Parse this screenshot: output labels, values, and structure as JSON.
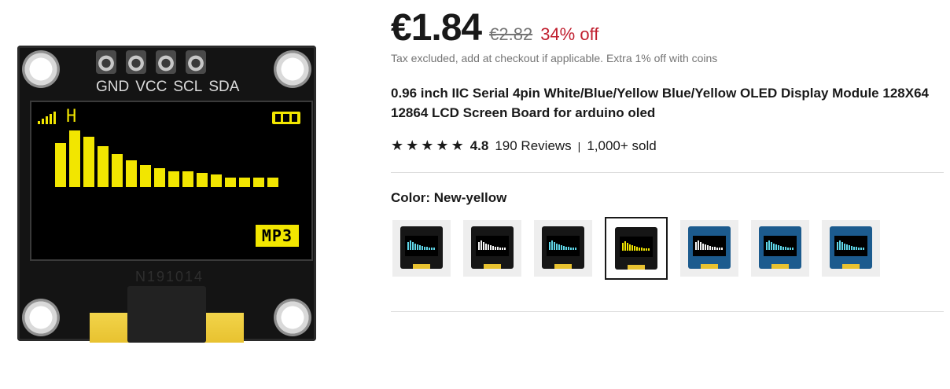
{
  "product_image": {
    "pin_labels": [
      "GND",
      "VCC",
      "SCL",
      "SDA"
    ],
    "screen_letter": "H",
    "screen_badge": "MP3",
    "chip_label": "N191014",
    "display_color": "#f2e600"
  },
  "price": {
    "current": "€1.84",
    "original": "€2.82",
    "discount": "34% off",
    "note": "Tax excluded, add at checkout if applicable. Extra 1% off with coins"
  },
  "title": "0.96 inch IIC Serial 4pin White/Blue/Yellow Blue/Yellow OLED Display Module 128X64 12864 LCD Screen Board for arduino oled",
  "rating": {
    "stars": 5,
    "value": "4.8",
    "reviews": "190 Reviews",
    "sold": "1,000+ sold"
  },
  "color": {
    "label": "Color: New-yellow",
    "options": [
      {
        "variant": "cyan",
        "board": "black",
        "selected": false
      },
      {
        "variant": "white",
        "board": "black",
        "selected": false
      },
      {
        "variant": "cyan",
        "board": "black",
        "selected": false
      },
      {
        "variant": "yellow",
        "board": "black",
        "selected": true
      },
      {
        "variant": "white",
        "board": "blue",
        "selected": false
      },
      {
        "variant": "cyan",
        "board": "blue",
        "selected": false
      },
      {
        "variant": "cyan",
        "board": "blue",
        "selected": false
      }
    ]
  },
  "colors": {
    "discount_red": "#c01e2e",
    "text_dark": "#191919",
    "text_muted": "#757575"
  }
}
